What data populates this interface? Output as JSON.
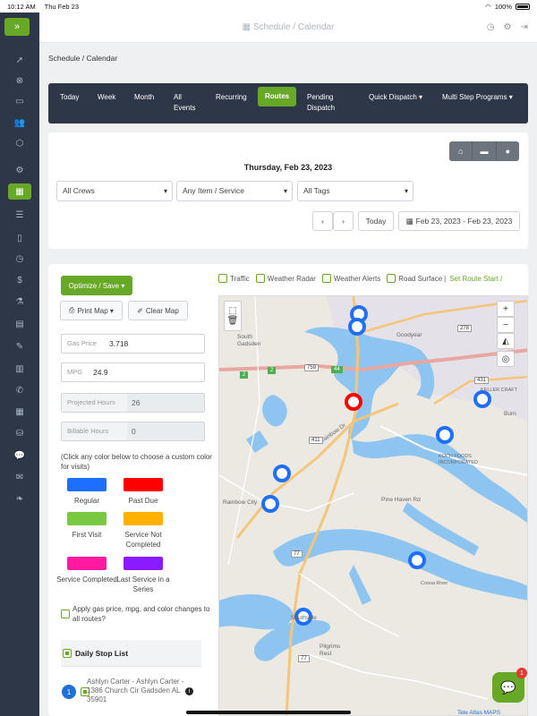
{
  "status": {
    "time": "10:12 AM",
    "day": "Thu Feb 23",
    "battery": "100%"
  },
  "header": {
    "title": "Schedule / Calendar"
  },
  "breadcrumb": "Schedule / Calendar",
  "nav": {
    "today": "Today",
    "week": "Week",
    "month": "Month",
    "all_events_1": "All",
    "all_events_2": "Events",
    "recurring": "Recurring",
    "routes": "Routes",
    "pending_1": "Pending",
    "pending_2": "Dispatch",
    "quick_dispatch": "Quick Dispatch ▾",
    "multi_step": "Multi Step Programs ▾"
  },
  "filters": {
    "date_title": "Thursday, Feb 23, 2023",
    "crews": "All Crews",
    "items": "Any Item / Service",
    "tags": "All Tags",
    "today_btn": "Today",
    "range": "Feb 23, 2023 - Feb 23, 2023"
  },
  "route": {
    "optimize": "Optimize / Save ▾",
    "print_map": "Print Map ▾",
    "clear_map": "Clear Map",
    "gas_label": "Gas Price",
    "gas_value": "3.718",
    "mpg_label": "MPG",
    "mpg_value": "24.9",
    "proj_label": "Projected Hours",
    "proj_value": "26",
    "bill_label": "Billable Hours",
    "bill_value": "0",
    "hint": "(Click any color below to choose a custom color for visits)",
    "colors": [
      {
        "label": "Regular",
        "color": "#1e6fff"
      },
      {
        "label": "Past Due",
        "color": "#ff0000"
      },
      {
        "label": "First Visit",
        "color": "#7ac943"
      },
      {
        "label": "Service Not Completed",
        "color": "#ffb000"
      },
      {
        "label": "Service Completed",
        "color": "#ff1aa0"
      },
      {
        "label": "Last Service in a Series",
        "color": "#8a1aff"
      }
    ],
    "apply_text": "Apply gas price, mpg, and color changes to all routes?",
    "daily_stop_list": "Daily Stop List",
    "stop_number": "1",
    "stop_text": "Ashlyn Carter - Ashlyn Carter - 1386 Church Cir Gadsden AL 35901"
  },
  "map_layers": {
    "traffic": "Traffic",
    "weather_radar": "Weather Radar",
    "weather_alerts": "Weather Alerts",
    "road_surface": "Road Surface",
    "separator": "|",
    "set_route_start": "Set Route Start /"
  },
  "map": {
    "places": {
      "south_gadsden_1": "South",
      "south_gadsden_2": "Gadsden",
      "rainbow_city": "Rainbow City",
      "pine_haven": "Pine Haven Rd",
      "southside": "Southside",
      "pilgrims_1": "Pilgrims",
      "pilgrims_2": "Rest",
      "burn": "Burn",
      "goodyear": "Goodyear",
      "koch_foods_1": "KOCH FOODS",
      "koch_foods_2": "INCORPORATED",
      "keller": "KELLER CRAFT",
      "rainbow_dr": "Rainbow Dr",
      "coosa_river": "Coosa River",
      "credit": "Tele Atlas MAPS"
    },
    "roads": {
      "r2a": "2",
      "r2b": "2",
      "r759": "759",
      "r44": "44",
      "r411": "411",
      "r278": "278",
      "r431": "431",
      "r77a": "77",
      "r77b": "77"
    }
  },
  "chat": {
    "badge": "1"
  }
}
